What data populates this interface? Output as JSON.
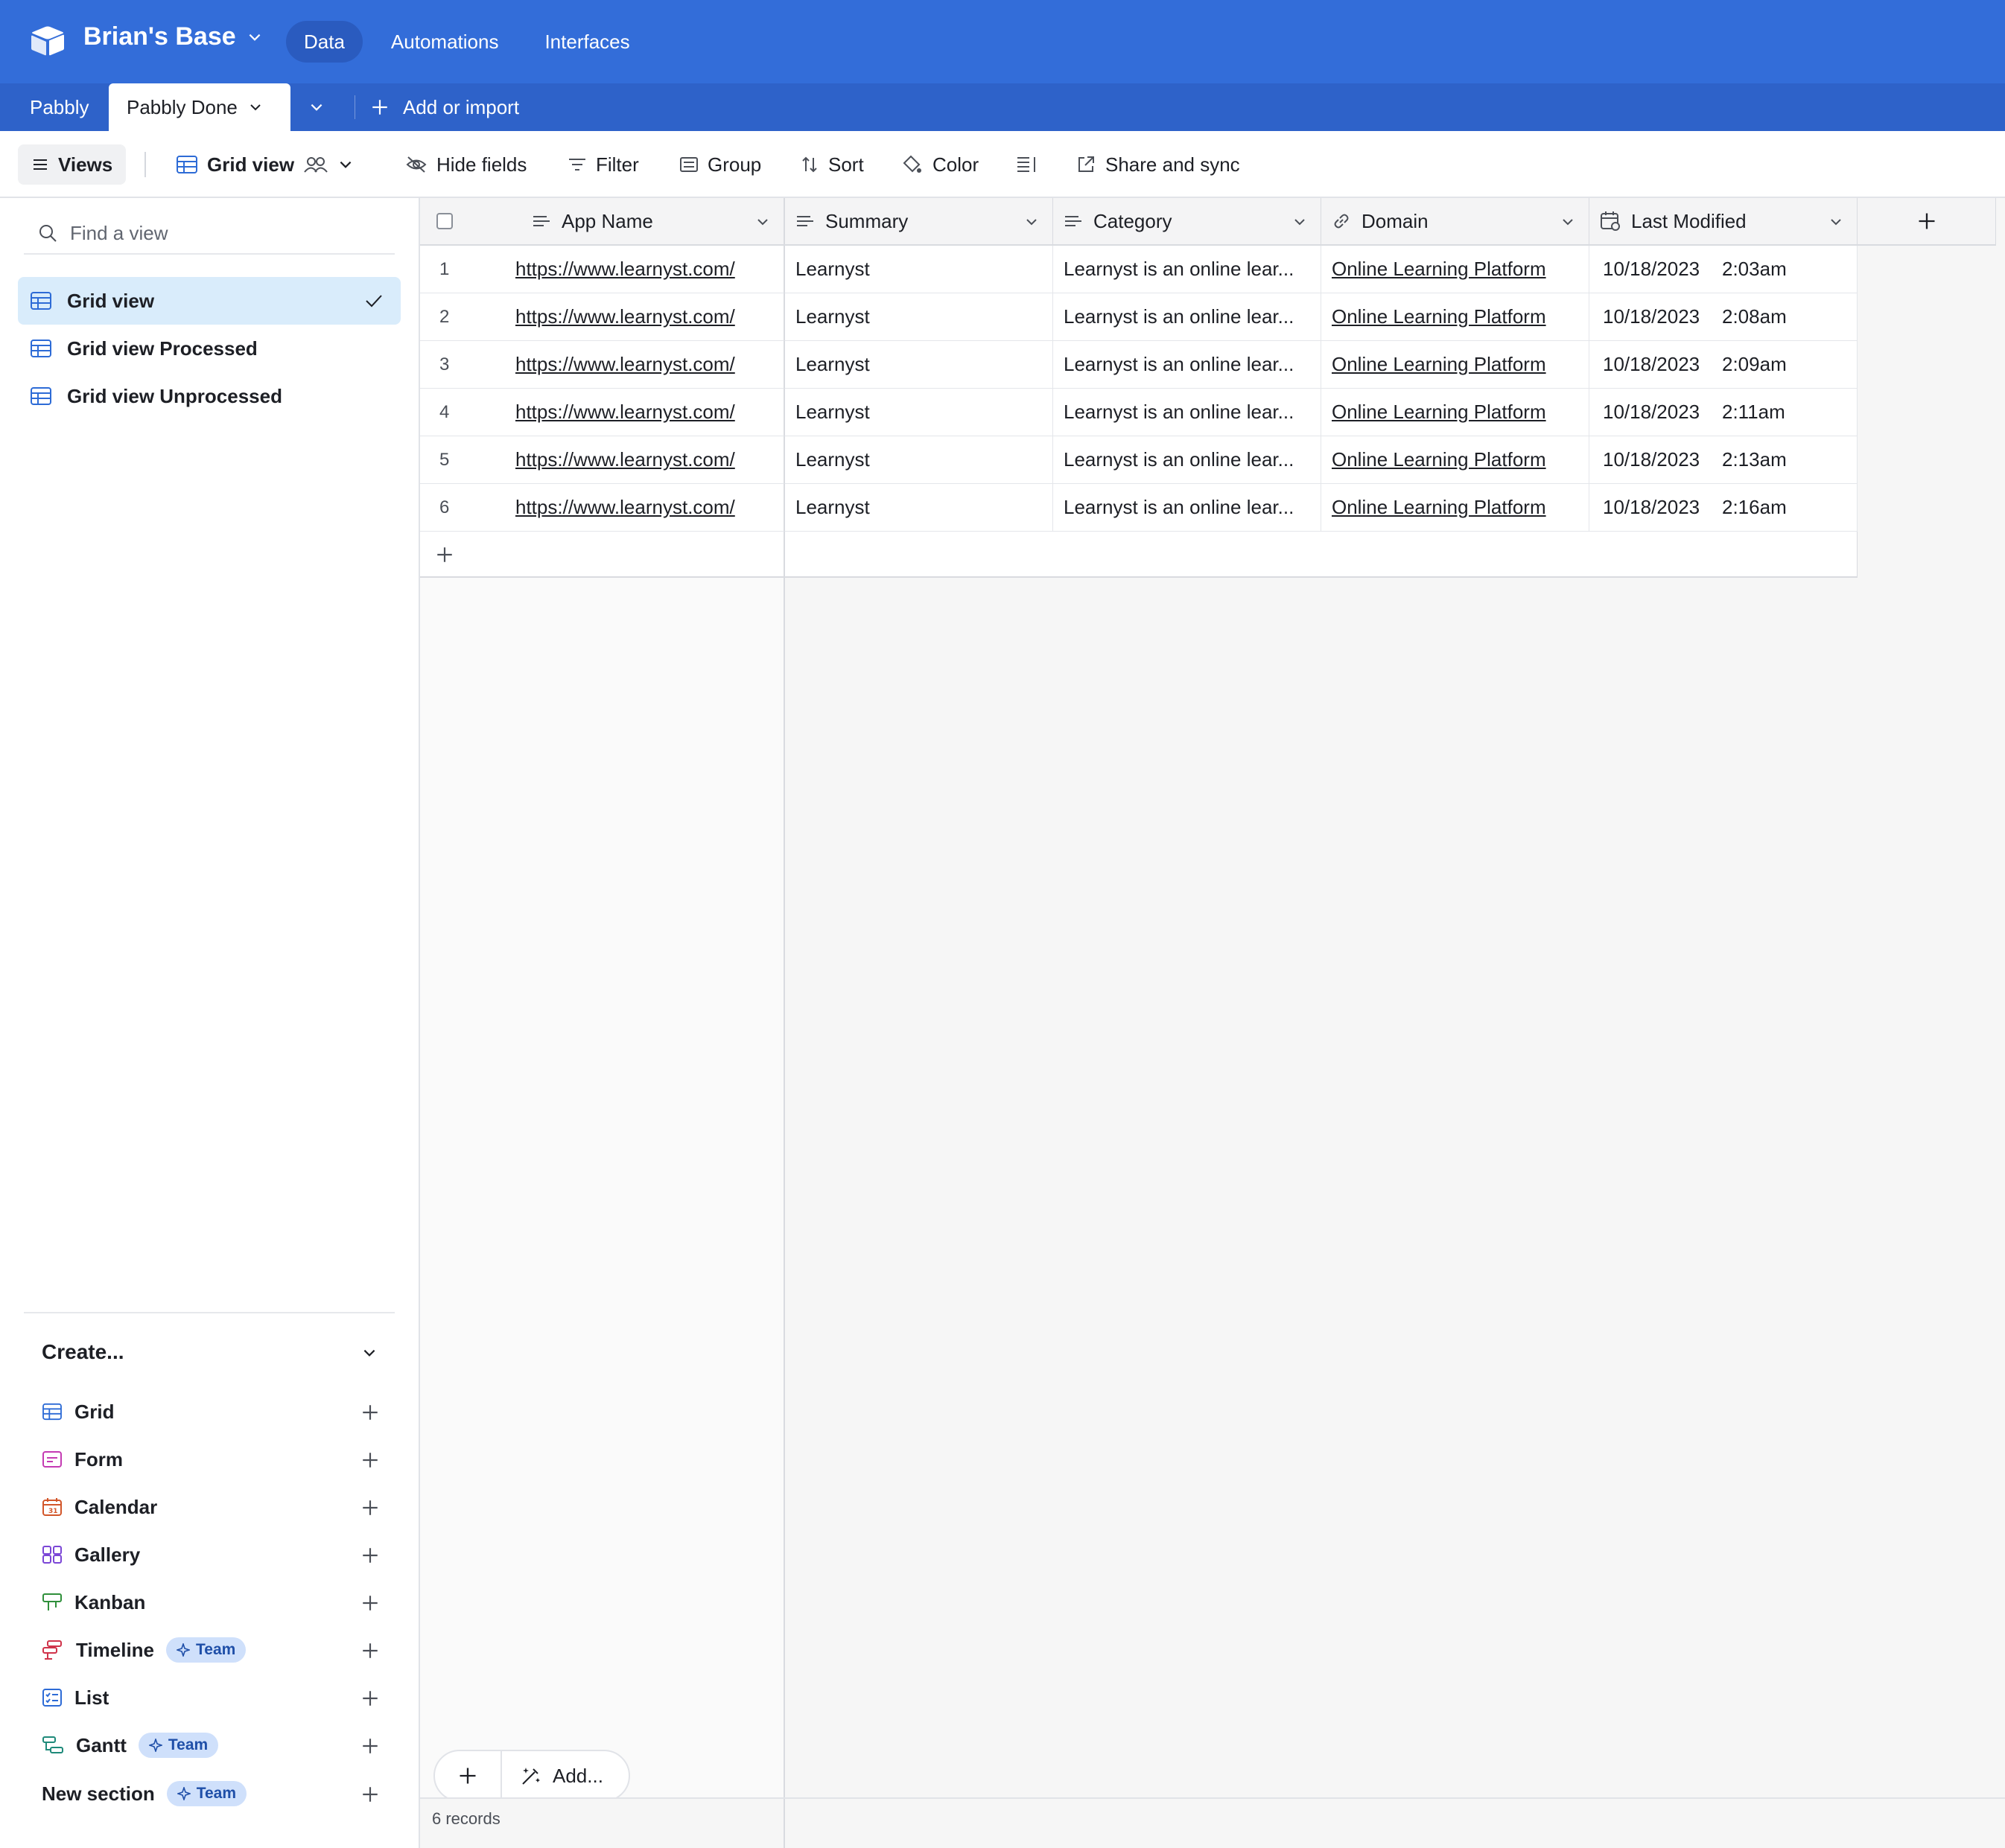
{
  "app": {
    "base_name": "Brian's Base",
    "nav": [
      "Data",
      "Automations",
      "Interfaces"
    ],
    "active_nav": "Data"
  },
  "tables": {
    "tabs": [
      "Pabbly",
      "Pabbly Done"
    ],
    "active": "Pabbly Done",
    "add_label": "Add or import"
  },
  "toolbar": {
    "views_label": "Views",
    "current_view": "Grid view",
    "hide_fields": "Hide fields",
    "filter": "Filter",
    "group": "Group",
    "sort": "Sort",
    "color": "Color",
    "share": "Share and sync"
  },
  "sidebar": {
    "search_placeholder": "Find a view",
    "views": [
      {
        "label": "Grid view",
        "active": true
      },
      {
        "label": "Grid view Processed",
        "active": false
      },
      {
        "label": "Grid view Unprocessed",
        "active": false
      }
    ],
    "create_title": "Create...",
    "create_items": [
      {
        "label": "Grid",
        "icon": "grid-icon",
        "color": "#2d6bd6"
      },
      {
        "label": "Form",
        "icon": "form-icon",
        "color": "#c43bb3"
      },
      {
        "label": "Calendar",
        "icon": "calendar-icon",
        "color": "#d2562a"
      },
      {
        "label": "Gallery",
        "icon": "gallery-icon",
        "color": "#7b46d6"
      },
      {
        "label": "Kanban",
        "icon": "kanban-icon",
        "color": "#2f8f3a"
      },
      {
        "label": "Timeline",
        "icon": "timeline-icon",
        "color": "#d0334a",
        "badge": "Team"
      },
      {
        "label": "List",
        "icon": "list-icon",
        "color": "#2d6bd6"
      },
      {
        "label": "Gantt",
        "icon": "gantt-icon",
        "color": "#1f8a7a",
        "badge": "Team"
      },
      {
        "label": "New section",
        "icon": "",
        "color": "",
        "badge": "Team"
      }
    ]
  },
  "grid": {
    "columns": [
      {
        "name": "App Name",
        "icon": "long-text-icon"
      },
      {
        "name": "Summary",
        "icon": "long-text-icon"
      },
      {
        "name": "Category",
        "icon": "long-text-icon"
      },
      {
        "name": "Domain",
        "icon": "link-icon"
      },
      {
        "name": "Last Modified",
        "icon": "calendar-icon"
      }
    ],
    "rows": [
      {
        "n": "1",
        "app": "https://www.learnyst.com/",
        "summary": "Learnyst",
        "category": "Learnyst is an online lear...",
        "domain": "Online Learning Platform",
        "date": "10/18/2023",
        "time": "2:03am"
      },
      {
        "n": "2",
        "app": "https://www.learnyst.com/",
        "summary": "Learnyst",
        "category": "Learnyst is an online lear...",
        "domain": "Online Learning Platform",
        "date": "10/18/2023",
        "time": "2:08am"
      },
      {
        "n": "3",
        "app": "https://www.learnyst.com/",
        "summary": "Learnyst",
        "category": "Learnyst is an online lear...",
        "domain": "Online Learning Platform",
        "date": "10/18/2023",
        "time": "2:09am"
      },
      {
        "n": "4",
        "app": "https://www.learnyst.com/",
        "summary": "Learnyst",
        "category": "Learnyst is an online lear...",
        "domain": "Online Learning Platform",
        "date": "10/18/2023",
        "time": "2:11am"
      },
      {
        "n": "5",
        "app": "https://www.learnyst.com/",
        "summary": "Learnyst",
        "category": "Learnyst is an online lear...",
        "domain": "Online Learning Platform",
        "date": "10/18/2023",
        "time": "2:13am"
      },
      {
        "n": "6",
        "app": "https://www.learnyst.com/",
        "summary": "Learnyst",
        "category": "Learnyst is an online lear...",
        "domain": "Online Learning Platform",
        "date": "10/18/2023",
        "time": "2:16am"
      }
    ],
    "add_label": "Add...",
    "record_count": "6 records"
  },
  "colors": {
    "appbar": "#336dd9",
    "tabbar": "#2e62c9",
    "active_view": "#d9ecfb",
    "team_badge": "#cfe0fb"
  }
}
